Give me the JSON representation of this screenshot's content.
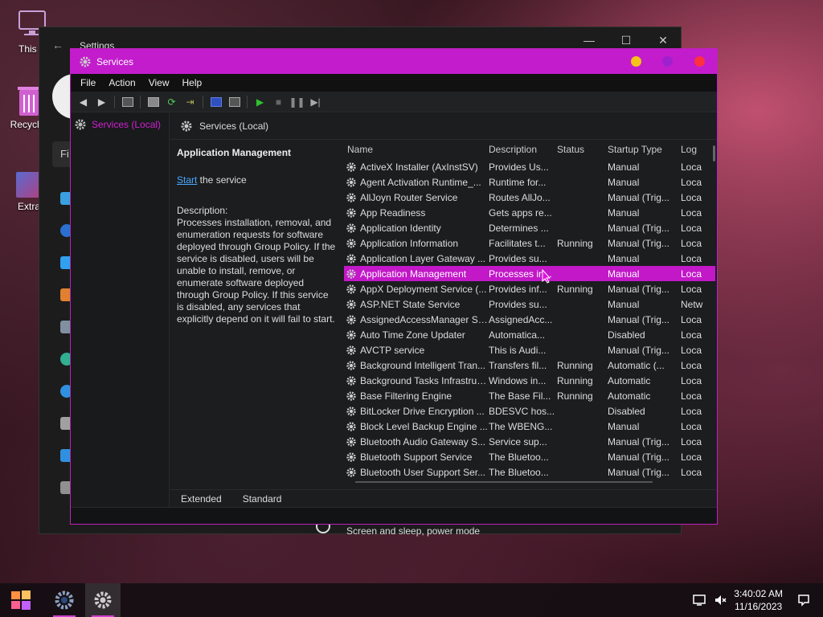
{
  "desktop": {
    "icons": [
      {
        "label": "This P"
      },
      {
        "label": "Recycle"
      },
      {
        "label": "Extra"
      }
    ]
  },
  "settings_window": {
    "title": "Settings",
    "search_prefix": "Fi",
    "footer_text": "Screen and sleep, power mode"
  },
  "services_window": {
    "title": "Services",
    "title_colors": {
      "bar": "#c21ccc",
      "minimize": "#f6c21a",
      "maximize": "#a020d0",
      "close": "#ff3040"
    },
    "menu": [
      "File",
      "Action",
      "View",
      "Help"
    ],
    "tree_item": "Services (Local)",
    "header_title": "Services (Local)",
    "detail": {
      "name": "Application Management",
      "start_link": "Start",
      "start_suffix": " the service",
      "description_label": "Description:",
      "description": "Processes installation, removal, and enumeration requests for software deployed through Group Policy. If the service is disabled, users will be unable to install, remove, or enumerate software deployed through Group Policy. If this service is disabled, any services that explicitly depend on it will fail to start."
    },
    "columns": {
      "name": "Name",
      "description": "Description",
      "status": "Status",
      "startup": "Startup Type",
      "log": "Log"
    },
    "rows": [
      {
        "name": "ActiveX Installer (AxInstSV)",
        "description": "Provides Us...",
        "status": "",
        "startup": "Manual",
        "log": "Loca"
      },
      {
        "name": "Agent Activation Runtime_...",
        "description": "Runtime for...",
        "status": "",
        "startup": "Manual",
        "log": "Loca"
      },
      {
        "name": "AllJoyn Router Service",
        "description": "Routes AllJo...",
        "status": "",
        "startup": "Manual (Trig...",
        "log": "Loca"
      },
      {
        "name": "App Readiness",
        "description": "Gets apps re...",
        "status": "",
        "startup": "Manual",
        "log": "Loca"
      },
      {
        "name": "Application Identity",
        "description": "Determines ...",
        "status": "",
        "startup": "Manual (Trig...",
        "log": "Loca"
      },
      {
        "name": "Application Information",
        "description": "Facilitates t...",
        "status": "Running",
        "startup": "Manual (Trig...",
        "log": "Loca"
      },
      {
        "name": "Application Layer Gateway ...",
        "description": "Provides su...",
        "status": "",
        "startup": "Manual",
        "log": "Loca"
      },
      {
        "name": "Application Management",
        "description": "Processes in...",
        "status": "",
        "startup": "Manual",
        "log": "Loca",
        "selected": true
      },
      {
        "name": "AppX Deployment Service (...",
        "description": "Provides inf...",
        "status": "Running",
        "startup": "Manual (Trig...",
        "log": "Loca"
      },
      {
        "name": "ASP.NET State Service",
        "description": "Provides su...",
        "status": "",
        "startup": "Manual",
        "log": "Netw"
      },
      {
        "name": "AssignedAccessManager Se...",
        "description": "AssignedAcc...",
        "status": "",
        "startup": "Manual (Trig...",
        "log": "Loca"
      },
      {
        "name": "Auto Time Zone Updater",
        "description": "Automatica...",
        "status": "",
        "startup": "Disabled",
        "log": "Loca"
      },
      {
        "name": "AVCTP service",
        "description": "This is Audi...",
        "status": "",
        "startup": "Manual (Trig...",
        "log": "Loca"
      },
      {
        "name": "Background Intelligent Tran...",
        "description": "Transfers fil...",
        "status": "Running",
        "startup": "Automatic (...",
        "log": "Loca"
      },
      {
        "name": "Background Tasks Infrastruc...",
        "description": "Windows in...",
        "status": "Running",
        "startup": "Automatic",
        "log": "Loca"
      },
      {
        "name": "Base Filtering Engine",
        "description": "The Base Fil...",
        "status": "Running",
        "startup": "Automatic",
        "log": "Loca"
      },
      {
        "name": "BitLocker Drive Encryption ...",
        "description": "BDESVC hos...",
        "status": "",
        "startup": "Disabled",
        "log": "Loca"
      },
      {
        "name": "Block Level Backup Engine ...",
        "description": "The WBENG...",
        "status": "",
        "startup": "Manual",
        "log": "Loca"
      },
      {
        "name": "Bluetooth Audio Gateway S...",
        "description": "Service sup...",
        "status": "",
        "startup": "Manual (Trig...",
        "log": "Loca"
      },
      {
        "name": "Bluetooth Support Service",
        "description": "The Bluetoo...",
        "status": "",
        "startup": "Manual (Trig...",
        "log": "Loca"
      },
      {
        "name": "Bluetooth User Support Ser...",
        "description": "The Bluetoo...",
        "status": "",
        "startup": "Manual (Trig...",
        "log": "Loca"
      }
    ],
    "tabs": [
      "Extended",
      "Standard"
    ]
  },
  "taskbar": {
    "time": "3:40:02 AM",
    "date": "11/16/2023"
  }
}
